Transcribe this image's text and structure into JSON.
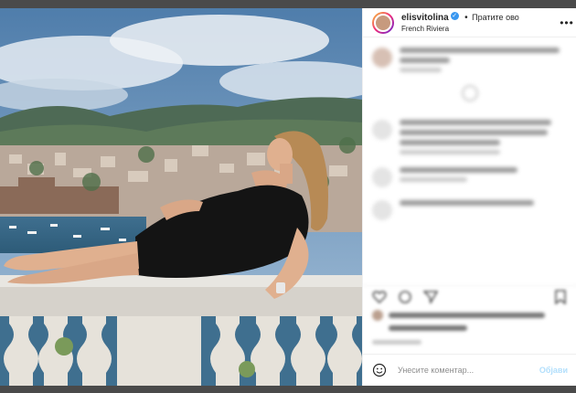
{
  "post": {
    "username": "elisvitolina",
    "verified_icon": "verified-badge-icon",
    "separator": "•",
    "follow_label": "Пратите ово",
    "location": "French Riviera",
    "more_icon": "more-options-icon"
  },
  "comment_box": {
    "placeholder": "Унесите коментар...",
    "post_label": "Објави",
    "emoji_icon": "emoji-icon"
  },
  "colors": {
    "accent_blue": "#3897f0",
    "post_button_disabled": "#b2dffc",
    "text": "#262626",
    "muted": "#8e8e8e"
  }
}
